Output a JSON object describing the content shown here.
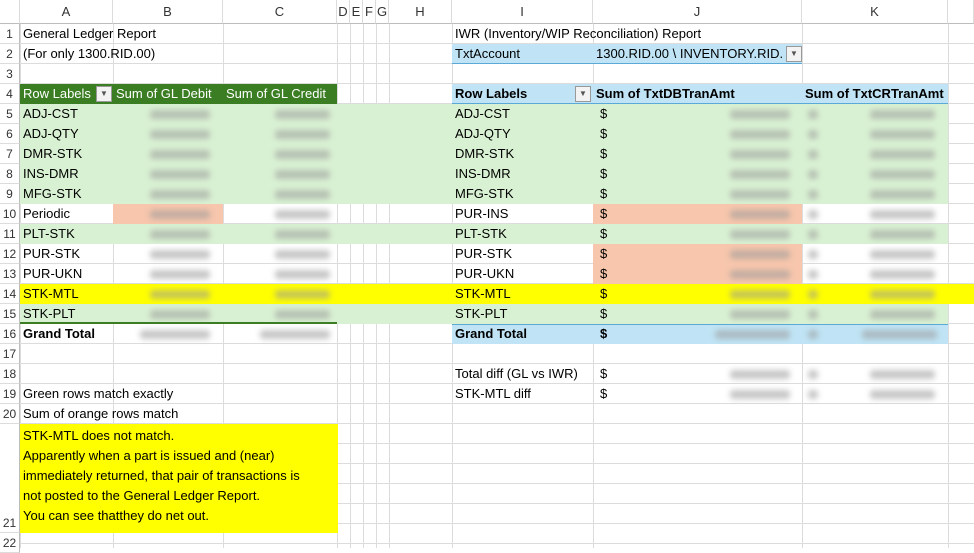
{
  "columns": [
    "A",
    "B",
    "C",
    "D",
    "E",
    "F",
    "G",
    "H",
    "I",
    "J",
    "K"
  ],
  "rows": [
    "1",
    "2",
    "3",
    "4",
    "5",
    "6",
    "7",
    "8",
    "9",
    "10",
    "11",
    "12",
    "13",
    "14",
    "15",
    "16",
    "17",
    "18",
    "19",
    "20",
    "21",
    "22"
  ],
  "colors": {
    "green": "#d9f1d3",
    "header_green": "#3a7d22",
    "orange": "#f7c6ac",
    "yellow": "#ffff00",
    "blue": "#c0e4f5"
  },
  "gl": {
    "title": "General Ledger Report",
    "subtitle": "(For only 1300.RID.00)",
    "headers": [
      "Row Labels",
      "Sum of GL Debit",
      "Sum of GL Credit"
    ],
    "row_labels": [
      "ADJ-CST",
      "ADJ-QTY",
      "DMR-STK",
      "INS-DMR",
      "MFG-STK",
      "Periodic",
      "PLT-STK",
      "PUR-STK",
      "PUR-UKN",
      "STK-MTL",
      "STK-PLT"
    ],
    "grand_total": "Grand Total"
  },
  "notes": {
    "green": "Green rows match exactly",
    "orange": "Sum of orange rows match",
    "yellow_lines": [
      "STK-MTL does not match.",
      "Apparently when a part is issued and (near)",
      "immediately returned, that pair of transactions is",
      "not posted to the General Ledger Report.",
      "You can see thatthey do net out."
    ]
  },
  "iwr": {
    "title": "IWR (Inventory/WIP Reconciliation) Report",
    "filter_label": "TxtAccount",
    "filter_value": "1300.RID.00 \\ INVENTORY.RID.",
    "headers": [
      "Row Labels",
      "Sum of TxtDBTranAmt",
      "Sum of TxtCRTranAmt"
    ],
    "row_labels": [
      "ADJ-CST",
      "ADJ-QTY",
      "DMR-STK",
      "INS-DMR",
      "MFG-STK",
      "PUR-INS",
      "PLT-STK",
      "PUR-STK",
      "PUR-UKN",
      "STK-MTL",
      "STK-PLT"
    ],
    "grand_total": "Grand Total",
    "currency": "$",
    "diff_labels": [
      "Total diff (GL vs IWR)",
      "STK-MTL diff"
    ]
  }
}
